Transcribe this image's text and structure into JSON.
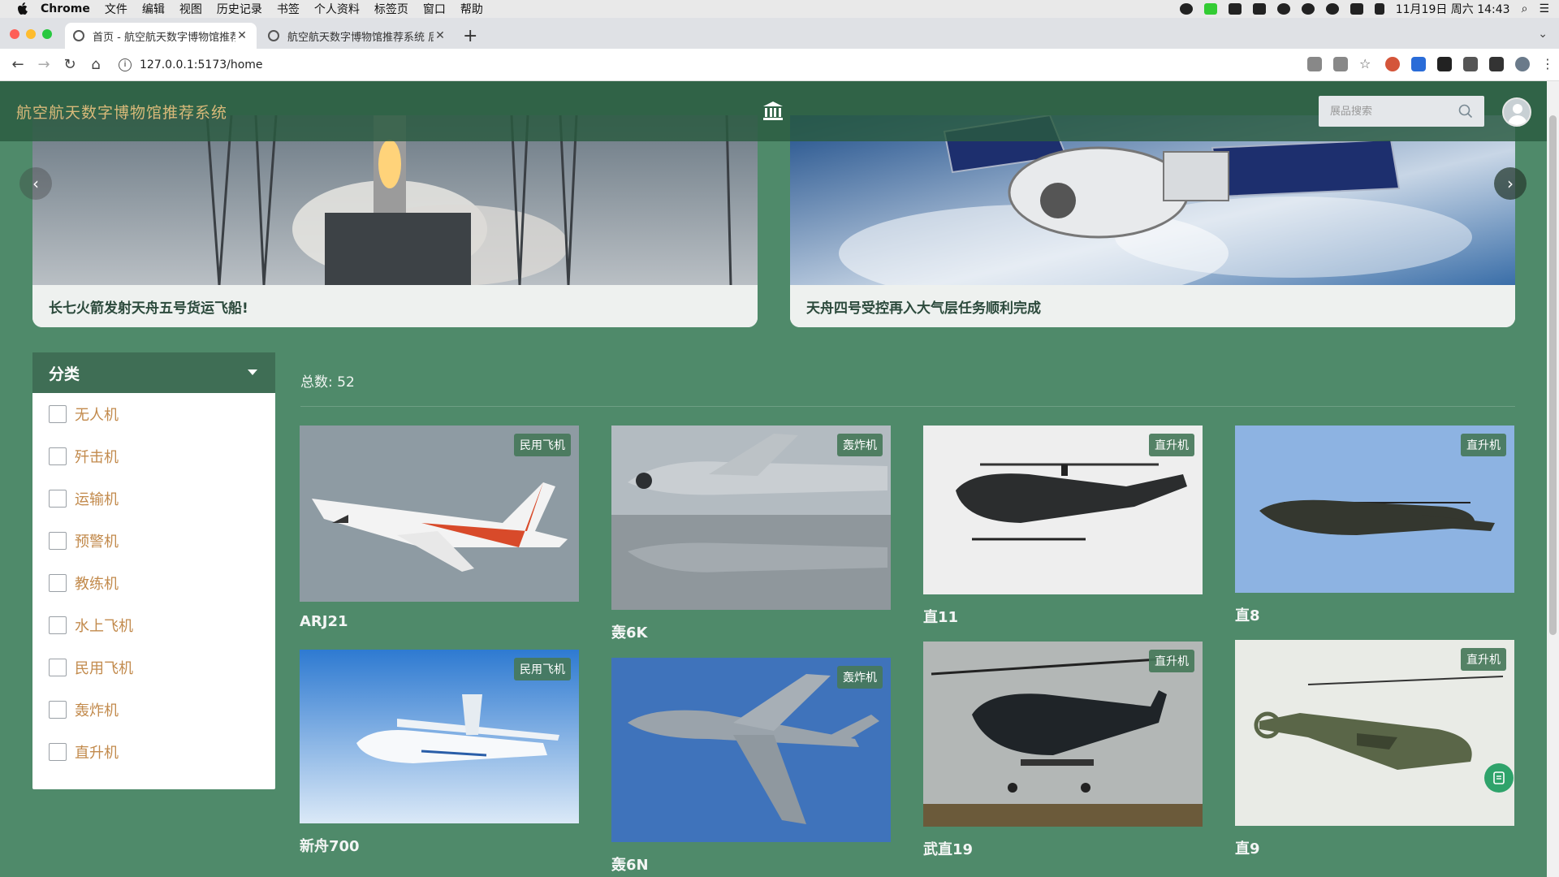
{
  "menubar": {
    "app": "Chrome",
    "items": [
      "文件",
      "编辑",
      "视图",
      "历史记录",
      "书签",
      "个人资料",
      "标签页",
      "窗口",
      "帮助"
    ],
    "clock": "11月19日 周六 14:43"
  },
  "tabs": [
    {
      "title": "首页 - 航空航天数字博物馆推荐系"
    },
    {
      "title": "航空航天数字博物馆推荐系统 后"
    }
  ],
  "browser": {
    "url": "127.0.0.1:5173/home"
  },
  "site": {
    "title": "航空航天数字博物馆推荐系统",
    "search_placeholder": "展品搜索"
  },
  "carousel": [
    {
      "caption": "长七火箭发射天舟五号货运飞船!"
    },
    {
      "caption": "天舟四号受控再入大气层任务顺利完成"
    }
  ],
  "filter": {
    "title": "分类",
    "options": [
      "无人机",
      "歼击机",
      "运输机",
      "预警机",
      "教练机",
      "水上飞机",
      "民用飞机",
      "轰炸机",
      "直升机"
    ]
  },
  "content": {
    "total_label": "总数: 52"
  },
  "items": [
    {
      "name": "ARJ21",
      "tag": "民用飞机"
    },
    {
      "name": "轰6K",
      "tag": "轰炸机"
    },
    {
      "name": "直11",
      "tag": "直升机"
    },
    {
      "name": "直8",
      "tag": "直升机"
    },
    {
      "name": "新舟700",
      "tag": "民用飞机"
    },
    {
      "name": "轰6N",
      "tag": "轰炸机"
    },
    {
      "name": "武直19",
      "tag": "直升机"
    },
    {
      "name": "直9",
      "tag": "直升机"
    }
  ],
  "colors": {
    "page_bg": "#4f8a6a",
    "header_bg": "#2a5a40",
    "title_gold": "#d9b97a",
    "filter_head": "#3f6e55",
    "filter_text": "#c28a4c",
    "tag_bg": "#46785a"
  }
}
